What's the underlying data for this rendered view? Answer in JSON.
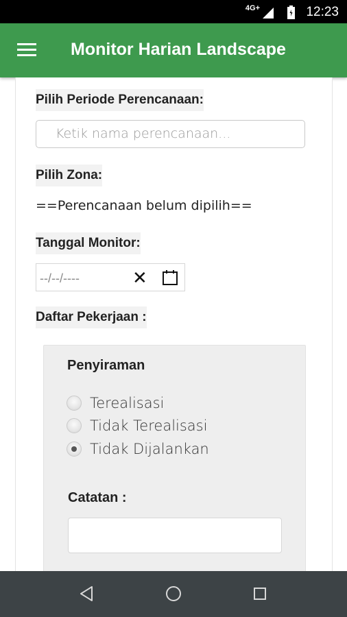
{
  "status_bar": {
    "network": "4G+",
    "time": "12:23"
  },
  "app_bar": {
    "title": "Monitor Harian Landscape",
    "menu_icon": "hamburger-menu-icon"
  },
  "form": {
    "periode_label": "Pilih Periode Perencanaan:",
    "periode_placeholder": "Ketik nama perencanaan...",
    "zona_label": "Pilih Zona:",
    "zona_status": "==Perencanaan belum dipilih==",
    "tanggal_label": "Tanggal Monitor:",
    "tanggal_value": "--/--/----",
    "daftar_label": "Daftar Pekerjaan :"
  },
  "task": {
    "name": "Penyiraman",
    "options": [
      {
        "label": "Terealisasi",
        "checked": false
      },
      {
        "label": "Tidak Terealisasi",
        "checked": false
      },
      {
        "label": "Tidak Dijalankan",
        "checked": true
      }
    ],
    "catatan_label": "Catatan :",
    "catatan_value": ""
  },
  "nav_bar": {
    "buttons": [
      "back-icon",
      "home-icon",
      "recents-icon"
    ]
  },
  "colors": {
    "app_bar": "#3e9a4e",
    "nav_bar": "#3d4346",
    "label_bg": "#f2f2f2",
    "card_bg": "#eeeeee"
  }
}
